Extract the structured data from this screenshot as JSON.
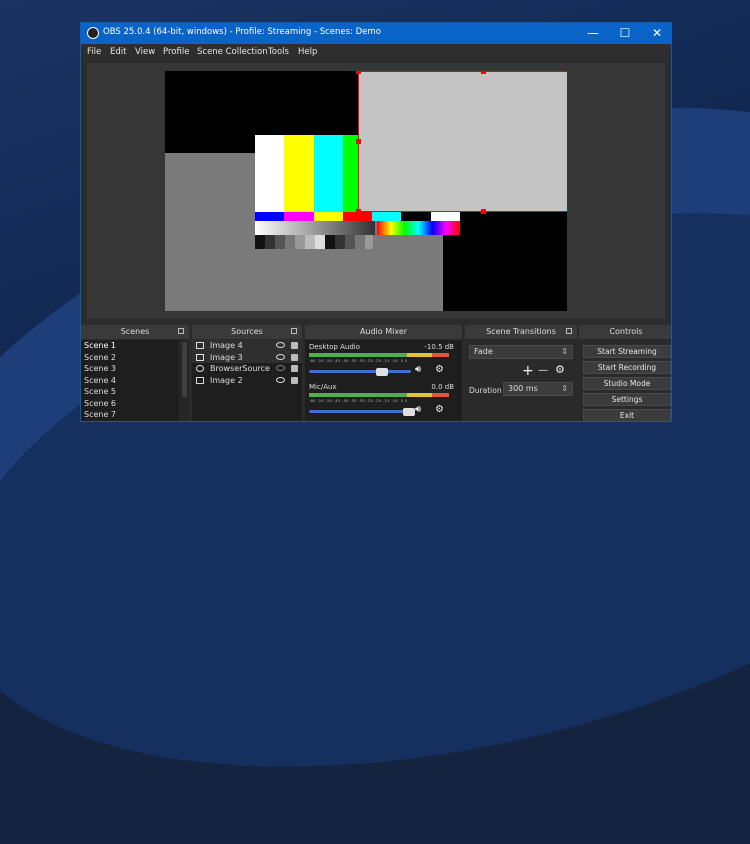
{
  "window": {
    "title": "OBS 25.0.4 (64-bit, windows) - Profile: Streaming - Scenes: Demo",
    "min_glyph": "—",
    "max_glyph": "☐",
    "close_glyph": "✕"
  },
  "menu": [
    "File",
    "Edit",
    "View",
    "Profile",
    "Scene Collection",
    "Tools",
    "Help"
  ],
  "docks": {
    "scenes_title": "Scenes",
    "sources_title": "Sources",
    "mixer_title": "Audio Mixer",
    "transitions_title": "Scene Transitions",
    "controls_title": "Controls"
  },
  "scenes": [
    "Scene 1",
    "Scene 2",
    "Scene 3",
    "Scene 4",
    "Scene 5",
    "Scene 6",
    "Scene 7"
  ],
  "sources": [
    "Image 4",
    "Image 3",
    "BrowserSource",
    "Image 2"
  ],
  "mixer": {
    "channel1": {
      "name": "Desktop Audio",
      "db": "-10.5 dB",
      "level": 0.72
    },
    "channel2": {
      "name": "Mic/Aux",
      "db": "0.0 dB",
      "level": 0.98
    },
    "ticks": "-60 -55 -50 -45 -40 -35 -30 -25 -20 -15 -10 -5 0"
  },
  "transitions": {
    "selected": "Fade",
    "plus": "+",
    "minus": "—",
    "duration_label": "Duration",
    "duration_value": "300 ms"
  },
  "controls": [
    "Start Streaming",
    "Start Recording",
    "Studio Mode",
    "Settings",
    "Exit"
  ],
  "colors": {
    "selection_border": "#ff0000",
    "titlebar": "#0a64c8",
    "color_bars": [
      "#ffffff",
      "#ffff00",
      "#00ffff",
      "#00ff00",
      "#ff00ff",
      "#ff0000",
      "#0000ff"
    ],
    "color_bars_bottom": [
      "#0000ff",
      "#ff00ff",
      "#ffff00",
      "#ff0000",
      "#00ffff",
      "#000000",
      "#ffffff"
    ]
  }
}
